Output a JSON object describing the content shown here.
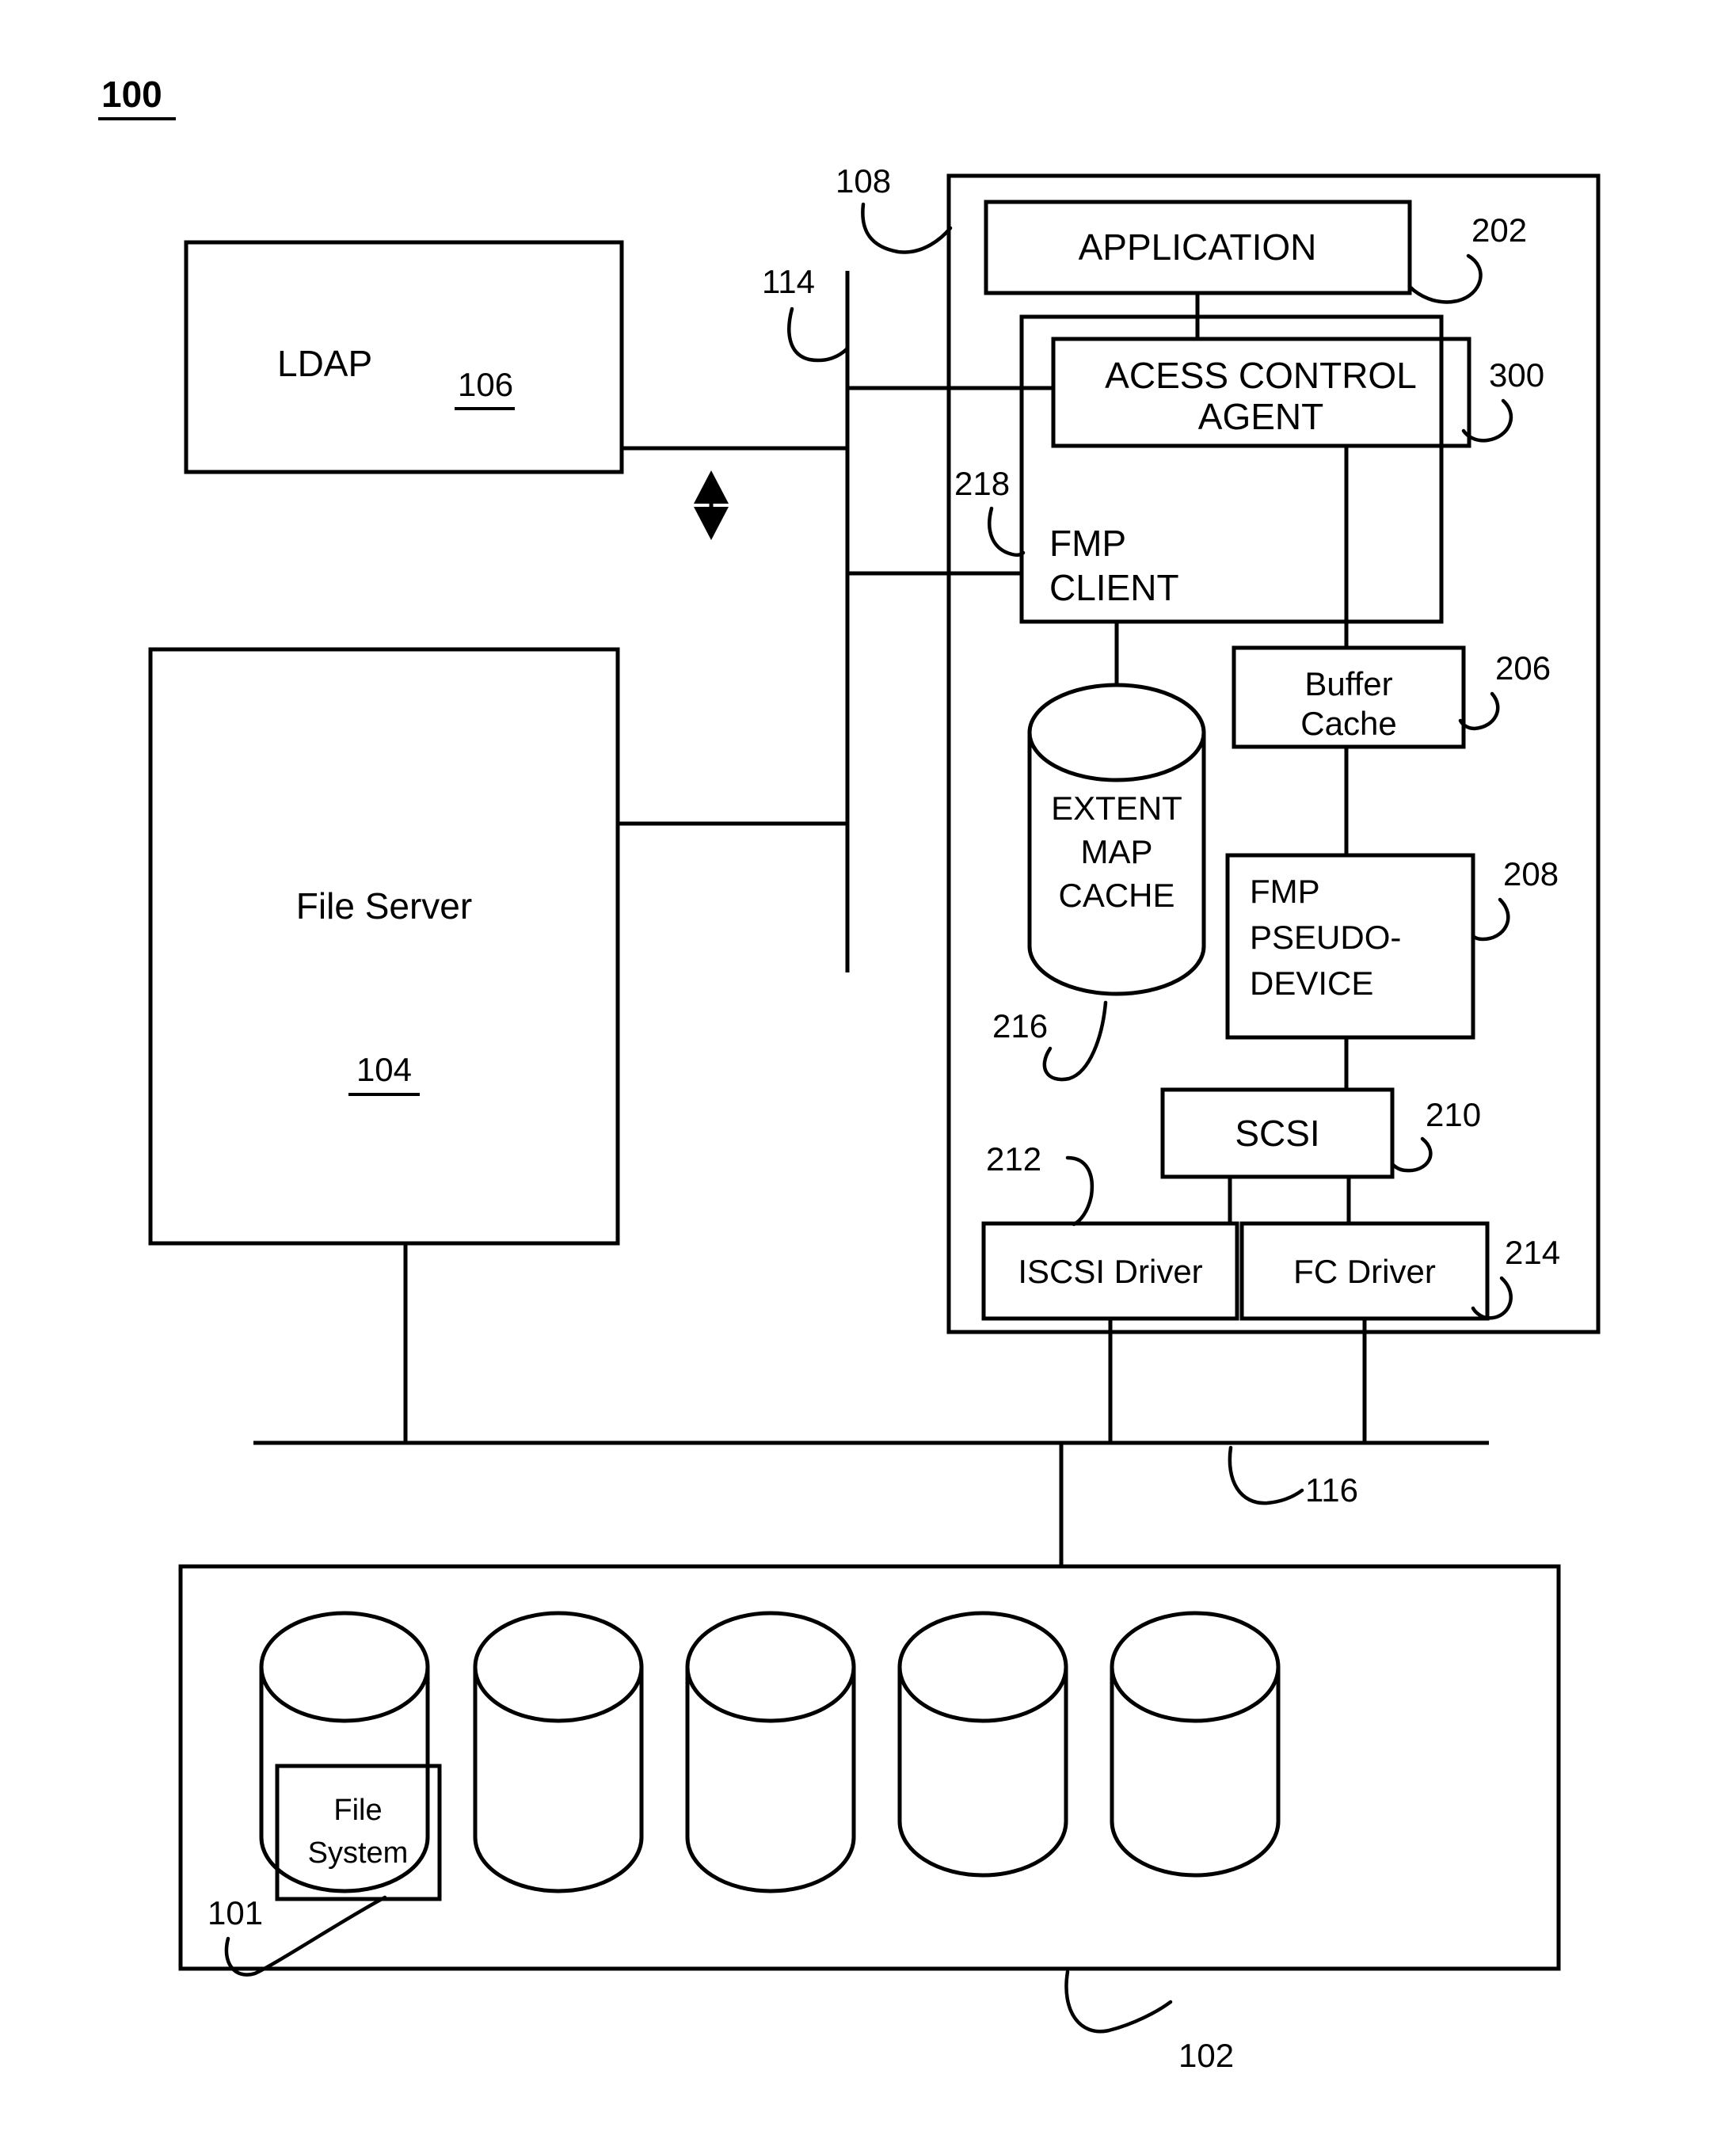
{
  "figure": {
    "number": "100",
    "type": "system-block-diagram"
  },
  "blocks": {
    "ldap": {
      "label": "LDAP",
      "ref": "106"
    },
    "file_server": {
      "label": "File Server",
      "ref": "104"
    },
    "host": {
      "ref": "108"
    },
    "bus_114": {
      "ref": "114"
    },
    "bus_116": {
      "ref": "116"
    },
    "application": {
      "label": "APPLICATION",
      "ref": "202"
    },
    "access_control_agent": {
      "label_line1": "ACESS CONTROL",
      "label_line2": "AGENT",
      "ref": "300"
    },
    "fmp_client": {
      "label_line1": "FMP",
      "label_line2": "CLIENT",
      "ref": "218"
    },
    "extent_map_cache": {
      "label_line1": "EXTENT",
      "label_line2": "MAP",
      "label_line3": "CACHE",
      "ref": "216"
    },
    "buffer_cache": {
      "label_line1": "Buffer",
      "label_line2": "Cache",
      "ref": "206"
    },
    "fmp_pseudo_device": {
      "label_line1": "FMP",
      "label_line2": "PSEUDO-",
      "label_line3": "DEVICE",
      "ref": "208"
    },
    "scsi": {
      "label": "SCSI",
      "ref": "210"
    },
    "iscsi_driver": {
      "label": "ISCSI Driver",
      "ref": "212"
    },
    "fc_driver": {
      "label": "FC Driver",
      "ref": "214"
    },
    "storage_array": {
      "ref": "102"
    },
    "file_system": {
      "label_line1": "File",
      "label_line2": "System",
      "ref": "101"
    }
  },
  "colors": {
    "stroke": "#000000",
    "background": "#ffffff"
  }
}
